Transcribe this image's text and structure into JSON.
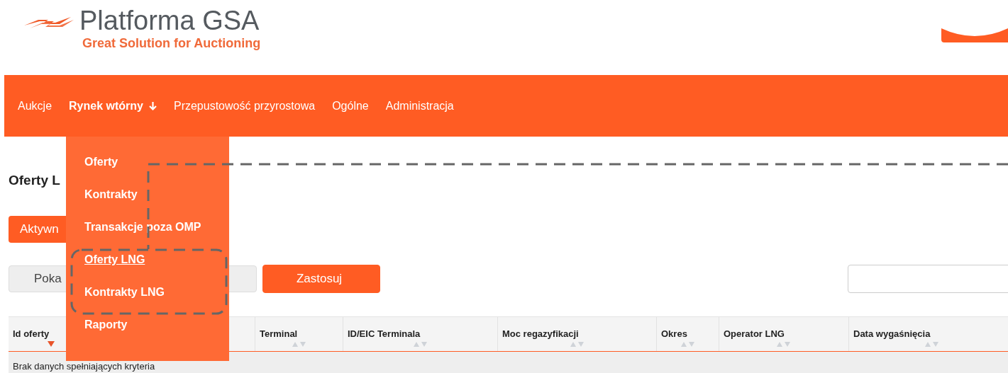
{
  "logo": {
    "title": "Platforma GSA",
    "tagline": "Great Solution for Auctioning"
  },
  "nav": [
    {
      "label": "Aukcje",
      "selected": false,
      "has_menu": false
    },
    {
      "label": "Rynek wtórny",
      "selected": true,
      "has_menu": true
    },
    {
      "label": "Przepustowość przyrostowa",
      "selected": false,
      "has_menu": false
    },
    {
      "label": "Ogólne",
      "selected": false,
      "has_menu": false
    },
    {
      "label": "Administracja",
      "selected": false,
      "has_menu": false
    }
  ],
  "dropdown": [
    {
      "label": "Oferty",
      "selected": false
    },
    {
      "label": "Kontrakty",
      "selected": false
    },
    {
      "label": "Transakcje poza OMP",
      "selected": false
    },
    {
      "label": "Oferty LNG",
      "selected": true
    },
    {
      "label": "Kontrakty LNG",
      "selected": false
    },
    {
      "label": "Raporty",
      "selected": false
    }
  ],
  "page_title": "Oferty L",
  "tabs": [
    {
      "label": "Aktywn",
      "selected": true
    }
  ],
  "filter_buttons": [
    {
      "label": "Poka",
      "kind": "plain"
    },
    {
      "kind": "plain"
    },
    {
      "label": "Zastosuj",
      "kind": "primary"
    }
  ],
  "table": {
    "columns": [
      {
        "label": "Id oferty",
        "sorted": true
      },
      {
        "label": "Terminal",
        "sorted": false
      },
      {
        "label": "ID/EIC Terminala",
        "sorted": false
      },
      {
        "label": "Moc regazyfikacji",
        "sorted": false
      },
      {
        "label": "Okres",
        "sorted": false
      },
      {
        "label": "Operator LNG",
        "sorted": false
      },
      {
        "label": "Data wygaśnięcia",
        "sorted": false
      }
    ],
    "empty_message": "Brak danych spełniających kryteria"
  }
}
